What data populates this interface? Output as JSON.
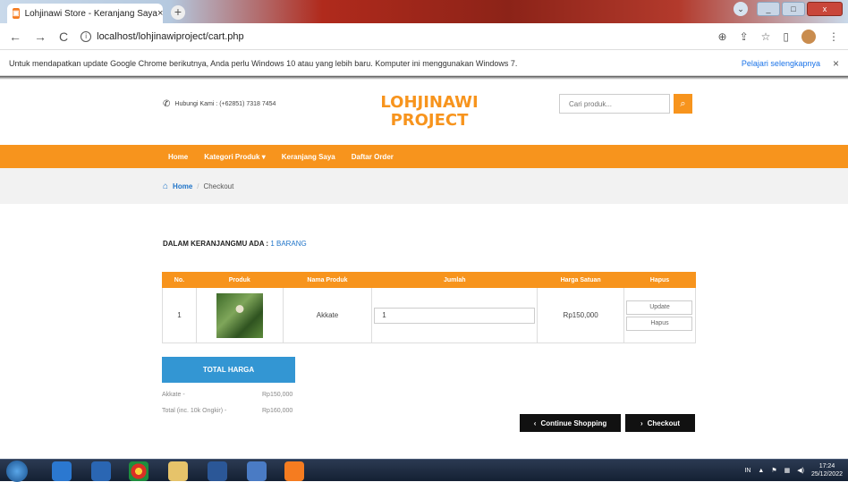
{
  "browser": {
    "tab_title": "Lohjinawi Store - Keranjang Saya",
    "tab_close": "×",
    "new_tab": "+",
    "url": "localhost/lohjinawiproject/cart.php"
  },
  "infobar": {
    "message": "Untuk mendapatkan update Google Chrome berikutnya, Anda perlu Windows 10 atau yang lebih baru. Komputer ini menggunakan Windows 7.",
    "link": "Pelajari selengkapnya",
    "close": "×"
  },
  "header": {
    "contact": "Hubungi Kami : (+62851) 7318 7454",
    "logo_line1": "LOHJINAWI",
    "logo_line2": "PROJECT",
    "search_placeholder": "Cari produk..."
  },
  "nav": {
    "items": [
      "Home",
      "Kategori Produk",
      "Keranjang Saya",
      "Daftar Order"
    ]
  },
  "breadcrumb": {
    "home": "Home",
    "separator": "/",
    "current": "Checkout"
  },
  "cart": {
    "count_label": "DALAM KERANJANGMU ADA :",
    "count_value": "1 BARANG"
  },
  "table": {
    "headers": [
      "No.",
      "Produk",
      "Nama Produk",
      "Jumlah",
      "Harga Satuan",
      "Hapus"
    ],
    "rows": [
      {
        "no": "1",
        "name": "Akkate",
        "qty": "1",
        "price": "Rp150,000",
        "update": "Update",
        "delete": "Hapus"
      }
    ]
  },
  "summary": {
    "title": "TOTAL HARGA",
    "line1_label": "Akkate -",
    "line1_value": "Rp150,000",
    "line2_label": "Total (inc. 10k Ongkir) -",
    "line2_value": "Rp160,000"
  },
  "buttons": {
    "continue": "Continue Shopping",
    "checkout": "Checkout"
  },
  "taskbar": {
    "lang": "IN",
    "time": "17:24",
    "date": "25/12/2022"
  },
  "colors": {
    "accent": "#f7941d",
    "blue": "#3396d3",
    "link": "#1f74c8"
  }
}
